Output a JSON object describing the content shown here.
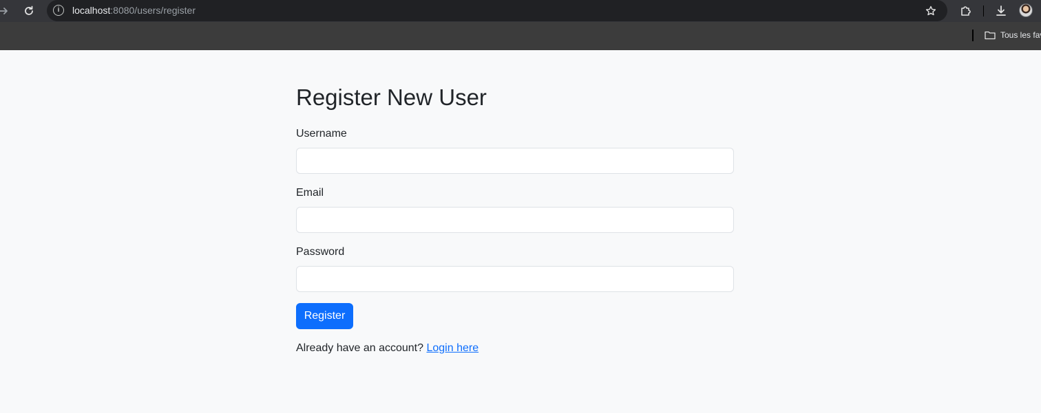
{
  "browser": {
    "url_host": "localhost",
    "url_rest": ":8080/users/register",
    "bookmarks_label": "Tous les fav",
    "icons": {
      "forward": "arrow-right-icon",
      "reload": "reload-icon",
      "site_info": "info-icon",
      "bookmark_star": "star-icon",
      "extensions": "puzzle-icon",
      "downloads": "download-icon",
      "profile": "avatar",
      "bookmarks_folder": "folder-icon"
    }
  },
  "page": {
    "title": "Register New User",
    "fields": {
      "username_label": "Username",
      "email_label": "Email",
      "password_label": "Password"
    },
    "register_button": "Register",
    "login_prompt": "Already have an account?",
    "login_link": "Login here"
  },
  "colors": {
    "primary": "#0d6efd",
    "page_background": "#f8f9fa",
    "text": "#212529"
  }
}
